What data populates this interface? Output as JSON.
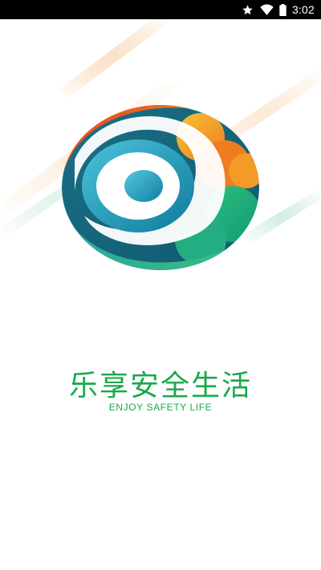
{
  "status_bar": {
    "time": "3:02",
    "icons": [
      "star-icon",
      "wifi-icon",
      "battery-icon"
    ]
  },
  "splash": {
    "slogan_cn": "乐享安全生活",
    "slogan_en": "ENJOY SAFETY LIFE"
  },
  "colors": {
    "slogan": "#1aa84a",
    "status_bar_bg": "#000000",
    "logo_red": "#e8381c",
    "logo_orange": "#f6a01a",
    "logo_teal": "#1a8f9a",
    "logo_green": "#2fb57a"
  }
}
